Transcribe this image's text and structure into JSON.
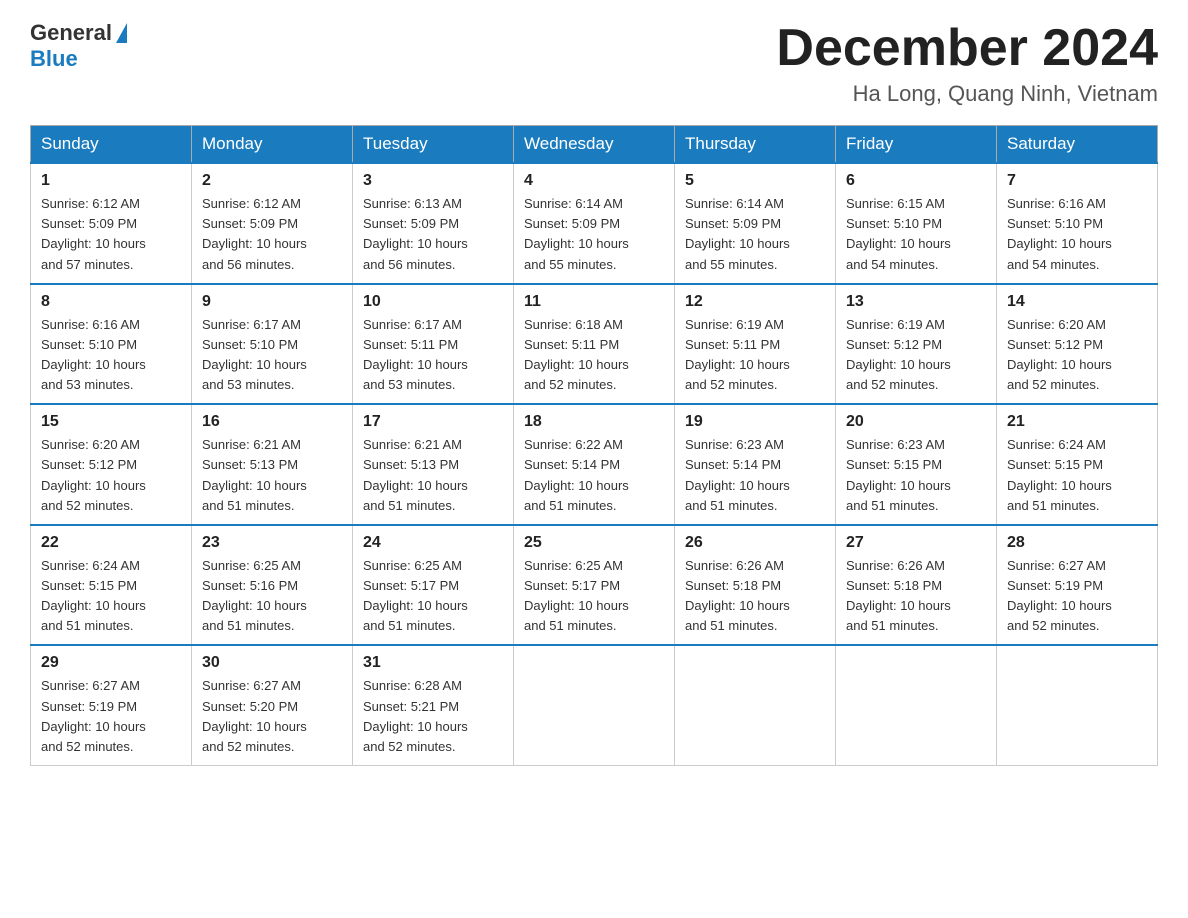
{
  "header": {
    "logo": {
      "text1": "General",
      "text2": "Blue"
    },
    "title": "December 2024",
    "location": "Ha Long, Quang Ninh, Vietnam"
  },
  "weekdays": [
    "Sunday",
    "Monday",
    "Tuesday",
    "Wednesday",
    "Thursday",
    "Friday",
    "Saturday"
  ],
  "weeks": [
    [
      {
        "day": "1",
        "sunrise": "6:12 AM",
        "sunset": "5:09 PM",
        "daylight": "10 hours and 57 minutes."
      },
      {
        "day": "2",
        "sunrise": "6:12 AM",
        "sunset": "5:09 PM",
        "daylight": "10 hours and 56 minutes."
      },
      {
        "day": "3",
        "sunrise": "6:13 AM",
        "sunset": "5:09 PM",
        "daylight": "10 hours and 56 minutes."
      },
      {
        "day": "4",
        "sunrise": "6:14 AM",
        "sunset": "5:09 PM",
        "daylight": "10 hours and 55 minutes."
      },
      {
        "day": "5",
        "sunrise": "6:14 AM",
        "sunset": "5:09 PM",
        "daylight": "10 hours and 55 minutes."
      },
      {
        "day": "6",
        "sunrise": "6:15 AM",
        "sunset": "5:10 PM",
        "daylight": "10 hours and 54 minutes."
      },
      {
        "day": "7",
        "sunrise": "6:16 AM",
        "sunset": "5:10 PM",
        "daylight": "10 hours and 54 minutes."
      }
    ],
    [
      {
        "day": "8",
        "sunrise": "6:16 AM",
        "sunset": "5:10 PM",
        "daylight": "10 hours and 53 minutes."
      },
      {
        "day": "9",
        "sunrise": "6:17 AM",
        "sunset": "5:10 PM",
        "daylight": "10 hours and 53 minutes."
      },
      {
        "day": "10",
        "sunrise": "6:17 AM",
        "sunset": "5:11 PM",
        "daylight": "10 hours and 53 minutes."
      },
      {
        "day": "11",
        "sunrise": "6:18 AM",
        "sunset": "5:11 PM",
        "daylight": "10 hours and 52 minutes."
      },
      {
        "day": "12",
        "sunrise": "6:19 AM",
        "sunset": "5:11 PM",
        "daylight": "10 hours and 52 minutes."
      },
      {
        "day": "13",
        "sunrise": "6:19 AM",
        "sunset": "5:12 PM",
        "daylight": "10 hours and 52 minutes."
      },
      {
        "day": "14",
        "sunrise": "6:20 AM",
        "sunset": "5:12 PM",
        "daylight": "10 hours and 52 minutes."
      }
    ],
    [
      {
        "day": "15",
        "sunrise": "6:20 AM",
        "sunset": "5:12 PM",
        "daylight": "10 hours and 52 minutes."
      },
      {
        "day": "16",
        "sunrise": "6:21 AM",
        "sunset": "5:13 PM",
        "daylight": "10 hours and 51 minutes."
      },
      {
        "day": "17",
        "sunrise": "6:21 AM",
        "sunset": "5:13 PM",
        "daylight": "10 hours and 51 minutes."
      },
      {
        "day": "18",
        "sunrise": "6:22 AM",
        "sunset": "5:14 PM",
        "daylight": "10 hours and 51 minutes."
      },
      {
        "day": "19",
        "sunrise": "6:23 AM",
        "sunset": "5:14 PM",
        "daylight": "10 hours and 51 minutes."
      },
      {
        "day": "20",
        "sunrise": "6:23 AM",
        "sunset": "5:15 PM",
        "daylight": "10 hours and 51 minutes."
      },
      {
        "day": "21",
        "sunrise": "6:24 AM",
        "sunset": "5:15 PM",
        "daylight": "10 hours and 51 minutes."
      }
    ],
    [
      {
        "day": "22",
        "sunrise": "6:24 AM",
        "sunset": "5:15 PM",
        "daylight": "10 hours and 51 minutes."
      },
      {
        "day": "23",
        "sunrise": "6:25 AM",
        "sunset": "5:16 PM",
        "daylight": "10 hours and 51 minutes."
      },
      {
        "day": "24",
        "sunrise": "6:25 AM",
        "sunset": "5:17 PM",
        "daylight": "10 hours and 51 minutes."
      },
      {
        "day": "25",
        "sunrise": "6:25 AM",
        "sunset": "5:17 PM",
        "daylight": "10 hours and 51 minutes."
      },
      {
        "day": "26",
        "sunrise": "6:26 AM",
        "sunset": "5:18 PM",
        "daylight": "10 hours and 51 minutes."
      },
      {
        "day": "27",
        "sunrise": "6:26 AM",
        "sunset": "5:18 PM",
        "daylight": "10 hours and 51 minutes."
      },
      {
        "day": "28",
        "sunrise": "6:27 AM",
        "sunset": "5:19 PM",
        "daylight": "10 hours and 52 minutes."
      }
    ],
    [
      {
        "day": "29",
        "sunrise": "6:27 AM",
        "sunset": "5:19 PM",
        "daylight": "10 hours and 52 minutes."
      },
      {
        "day": "30",
        "sunrise": "6:27 AM",
        "sunset": "5:20 PM",
        "daylight": "10 hours and 52 minutes."
      },
      {
        "day": "31",
        "sunrise": "6:28 AM",
        "sunset": "5:21 PM",
        "daylight": "10 hours and 52 minutes."
      },
      null,
      null,
      null,
      null
    ]
  ],
  "labels": {
    "sunrise": "Sunrise:",
    "sunset": "Sunset:",
    "daylight": "Daylight:"
  }
}
